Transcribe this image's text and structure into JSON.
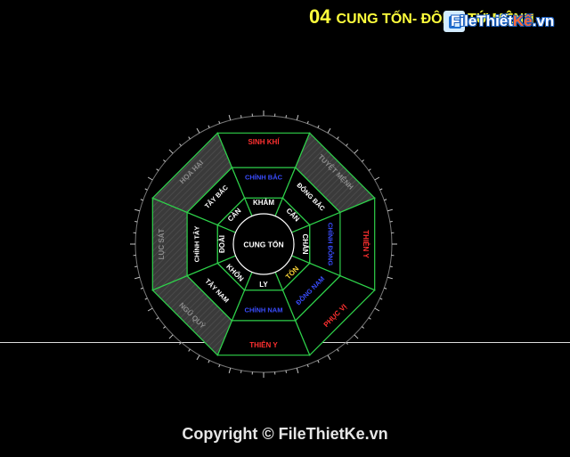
{
  "title": {
    "number": "04",
    "text": "CUNG TỐN- ĐÔNG TỨ MỆNH"
  },
  "logo": {
    "part1": "File",
    "part2": "Thiết",
    "part3": "Kế",
    "part4": ".vn"
  },
  "center_label": "CUNG TỐN",
  "outer_ring": [
    {
      "name": "SINH KHÍ",
      "color": "#ff3030",
      "shaded": false
    },
    {
      "name": "TUYỆT MỆNH",
      "color": "#8c8c8c",
      "shaded": true
    },
    {
      "name": "THIÊN Y",
      "color": "#ff3030",
      "shaded": false
    },
    {
      "name": "PHỤC VỊ",
      "color": "#ff3030",
      "shaded": false
    },
    {
      "name": "THIÊN Y",
      "color": "#ff3030",
      "shaded": false
    },
    {
      "name": "NGŨ QUỶ",
      "color": "#8c8c8c",
      "shaded": true
    },
    {
      "name": "LỤC SÁT",
      "color": "#8c8c8c",
      "shaded": true
    },
    {
      "name": "HỌA HẠI",
      "color": "#8c8c8c",
      "shaded": true
    }
  ],
  "direction_ring": [
    {
      "name": "CHÍNH BẮC",
      "color": "#3a4dff"
    },
    {
      "name": "ĐÔNG BẮC",
      "color": "#ffffff"
    },
    {
      "name": "CHÍNH ĐÔNG",
      "color": "#3a4dff"
    },
    {
      "name": "ĐÔNG NAM",
      "color": "#3a4dff"
    },
    {
      "name": "CHÍNH NAM",
      "color": "#3a4dff"
    },
    {
      "name": "TÂY NAM",
      "color": "#ffffff"
    },
    {
      "name": "CHÍNH TÂY",
      "color": "#ffffff"
    },
    {
      "name": "TÂY BẮC",
      "color": "#ffffff"
    }
  ],
  "trigram_ring": [
    {
      "name": "KHẢM",
      "color": "#ffffff"
    },
    {
      "name": "CẤN",
      "color": "#ffffff"
    },
    {
      "name": "CHẤN",
      "color": "#ffffff"
    },
    {
      "name": "TỐN",
      "color": "#ffd83a"
    },
    {
      "name": "LY",
      "color": "#ffffff"
    },
    {
      "name": "KHÔN",
      "color": "#ffffff"
    },
    {
      "name": "ĐOÀI",
      "color": "#ffffff"
    },
    {
      "name": "CÀN",
      "color": "#ffffff"
    }
  ],
  "colors": {
    "ring_lines": "#2ed14a",
    "scale": "#c8c8c8",
    "title": "#ffff3c"
  },
  "copyright": "Copyright © FileThietKe.vn"
}
